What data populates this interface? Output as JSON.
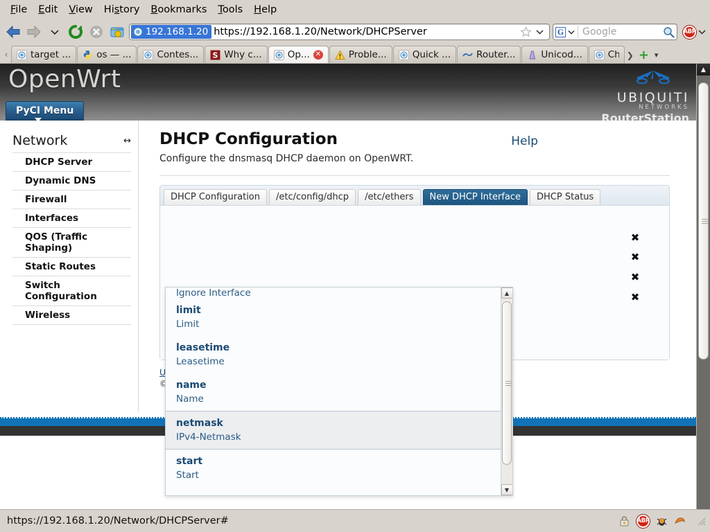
{
  "browser": {
    "menu": [
      {
        "label": "File",
        "accel": "F"
      },
      {
        "label": "Edit",
        "accel": "E"
      },
      {
        "label": "View",
        "accel": "V"
      },
      {
        "label": "History",
        "accel": "s"
      },
      {
        "label": "Bookmarks",
        "accel": "B"
      },
      {
        "label": "Tools",
        "accel": "T"
      },
      {
        "label": "Help",
        "accel": "H"
      }
    ],
    "nav": {
      "back_icon": "back-arrow-icon",
      "forward_icon": "forward-arrow-icon",
      "history_caret_icon": "chevron-down-icon",
      "reload_icon": "reload-icon",
      "stop_icon": "stop-icon",
      "home_icon": "home-icon"
    },
    "url": {
      "identity_host": "192.168.1.20",
      "rest": "https://192.168.1.20/Network/DHCPServer",
      "star_icon": "bookmark-star-icon",
      "dropdown_icon": "chevron-down-icon"
    },
    "search": {
      "engine_letter": "G",
      "engine_icon": "google-icon",
      "placeholder": "Google",
      "magnifier_icon": "search-icon"
    },
    "addons": {
      "abp_label": "ABP",
      "abp_icon": "adblock-plus-icon",
      "caret_icon": "chevron-down-icon"
    },
    "tabs": [
      {
        "label": "target ...",
        "favicon": "globe-icon",
        "active": false,
        "closable": false
      },
      {
        "label": "os — ...",
        "favicon": "python-icon",
        "active": false,
        "closable": false
      },
      {
        "label": "Contes...",
        "favicon": "globe-icon",
        "active": false,
        "closable": false
      },
      {
        "label": "Why c...",
        "favicon": "stackoverflow-icon",
        "active": false,
        "closable": false
      },
      {
        "label": "Op...",
        "favicon": "globe-icon",
        "active": true,
        "closable": true
      },
      {
        "label": "Proble...",
        "favicon": "warning-icon",
        "active": false,
        "closable": false
      },
      {
        "label": "Quick ...",
        "favicon": "globe-icon",
        "active": false,
        "closable": false
      },
      {
        "label": "Router...",
        "favicon": "ubiquiti-icon",
        "active": false,
        "closable": false
      },
      {
        "label": "Unicod...",
        "favicon": "unicode-icon",
        "active": false,
        "closable": false
      },
      {
        "label": "Ch",
        "favicon": "globe-icon",
        "active": false,
        "closable": false
      }
    ],
    "tab_controls": {
      "scroll_left_icon": "chevron-left-icon",
      "scroll_right_icon": "chevron-right-icon",
      "new_tab_label": "+",
      "list_all_icon": "chevron-down-icon"
    },
    "statusbar": {
      "url": "https://192.168.1.20/Network/DHCPServer#",
      "icons": [
        "lock-icon",
        "adblock-plus-icon",
        "firebug-icon",
        "firefox-icon"
      ],
      "resize_grip_icon": "resize-grip-icon"
    }
  },
  "page": {
    "header": {
      "logo": "OpenWrt",
      "menu_button": "PyCI Menu",
      "menu_caret_icon": "caret-down-icon",
      "vendor_name": "UBIQUITI",
      "vendor_sub": "NETWORKS",
      "product": "RouterStation",
      "vendor_mark_icon": "ubiquiti-burst-icon"
    },
    "sidebar": {
      "title": "Network",
      "collapse_icon": "collapse-arrows-icon",
      "items": [
        {
          "label": "DHCP Server"
        },
        {
          "label": "Dynamic DNS"
        },
        {
          "label": "Firewall"
        },
        {
          "label": "Interfaces"
        },
        {
          "label": "QOS (Traffic Shaping)"
        },
        {
          "label": "Static Routes"
        },
        {
          "label": "Switch Configuration"
        },
        {
          "label": "Wireless"
        }
      ]
    },
    "main": {
      "title": "DHCP Configuration",
      "help_label": "Help",
      "description": "Configure the dnsmasq DHCP daemon on OpenWRT.",
      "tabs": [
        {
          "label": "DHCP Configuration",
          "active": false
        },
        {
          "label": "/etc/config/dhcp",
          "active": false
        },
        {
          "label": "/etc/ethers",
          "active": false
        },
        {
          "label": "New DHCP Interface",
          "active": true
        },
        {
          "label": "DHCP Status",
          "active": false
        }
      ],
      "remove_rows": [
        {
          "icon": "remove-x-icon"
        },
        {
          "icon": "remove-x-icon"
        },
        {
          "icon": "remove-x-icon"
        },
        {
          "icon": "remove-x-icon"
        }
      ],
      "footer_link": "U",
      "footer_copy": "©"
    },
    "autocomplete": {
      "partial_top": "Ignore Interface",
      "items": [
        {
          "key": "limit",
          "desc": "Limit",
          "selected": false
        },
        {
          "key": "leasetime",
          "desc": "Leasetime",
          "selected": false
        },
        {
          "key": "name",
          "desc": "Name",
          "selected": false
        },
        {
          "key": "netmask",
          "desc": "IPv4-Netmask",
          "selected": true
        },
        {
          "key": "start",
          "desc": "Start",
          "selected": false
        }
      ],
      "scroll_up_icon": "scroll-up-icon",
      "scroll_down_icon": "scroll-down-icon"
    }
  },
  "colors": {
    "chrome_bg": "#d8d4cd",
    "url_highlight": "#3875d7",
    "active_tab_blue": "#1d5480",
    "link_blue": "#1c4a73",
    "page_bottom_blue": "#1173b6",
    "page_bottom_dark": "#333333",
    "ac_selected_bg": "#eceef0"
  }
}
